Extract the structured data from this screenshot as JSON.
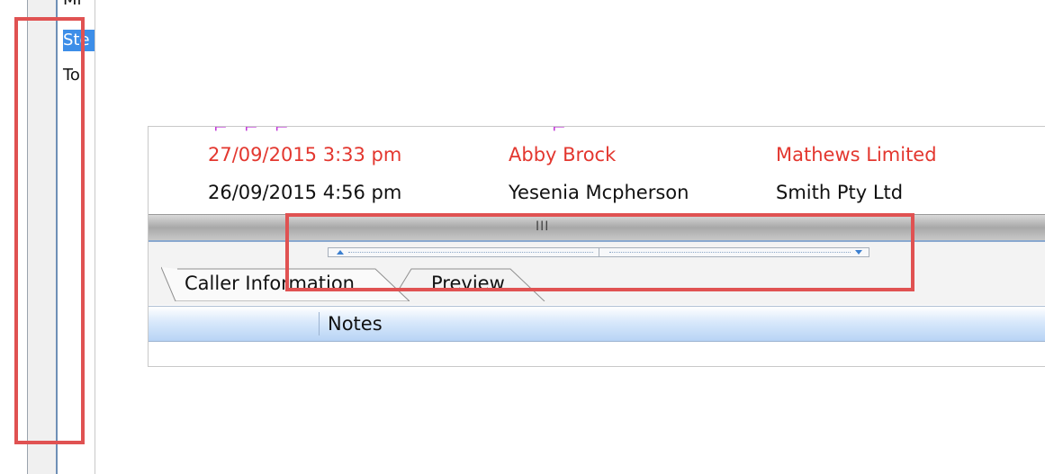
{
  "left_list": {
    "items": [
      {
        "label": "Mi"
      },
      {
        "label": "Ste",
        "selected": true
      },
      {
        "label": "To"
      }
    ]
  },
  "records": [
    {
      "datetime": "27/09/2015 3:33 pm",
      "caller": "Abby Brock",
      "company": "Mathews Limited",
      "color": "#e3372f"
    },
    {
      "datetime": "26/09/2015 4:56 pm",
      "caller": "Yesenia Mcpherson",
      "company": "Smith Pty Ltd",
      "color": "#111111"
    }
  ],
  "splitter": {
    "grip": "III"
  },
  "tabs": [
    {
      "label": "Caller Information"
    },
    {
      "label": "Preview"
    }
  ],
  "grid": {
    "columns": [
      "",
      "Notes"
    ]
  },
  "colors": {
    "highlight": "#e05252",
    "selection": "#3d8ee8",
    "accent_arrow": "#3b7fd0"
  }
}
